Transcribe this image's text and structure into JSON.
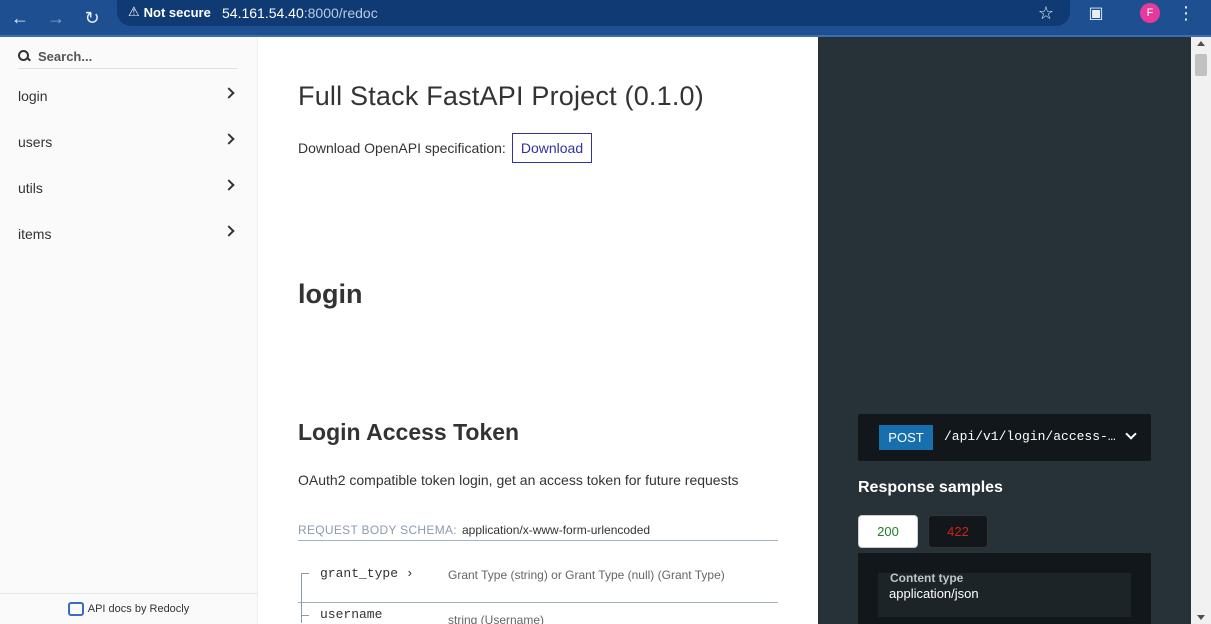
{
  "browser": {
    "security_label": "Not secure",
    "url_host": "54.161.54.40",
    "url_rest": ":8000/redoc",
    "avatar_letter": "F"
  },
  "sidebar": {
    "search_placeholder": "Search...",
    "items": [
      {
        "label": "login"
      },
      {
        "label": "users"
      },
      {
        "label": "utils"
      },
      {
        "label": "items"
      }
    ],
    "footer": "API docs by Redocly"
  },
  "main": {
    "title": "Full Stack FastAPI Project (0.1.0)",
    "download_label": "Download OpenAPI specification:",
    "download_button": "Download",
    "section_title": "login",
    "operation": {
      "title": "Login Access Token",
      "description": "OAuth2 compatible token login, get an access token for future requests",
      "schema_label": "REQUEST BODY SCHEMA:",
      "schema_type": "application/x-www-form-urlencoded",
      "fields": [
        {
          "name": "grant_type",
          "desc": "Grant Type (string) or Grant Type (null) (Grant Type)"
        },
        {
          "name": "username",
          "desc": "string (Username)"
        }
      ]
    }
  },
  "right_panel": {
    "method": "POST",
    "path": "/api/v1/login/access-…",
    "responses_title": "Response samples",
    "tabs": [
      "200",
      "422"
    ],
    "content_type_label": "Content type",
    "content_type_value": "application/json"
  },
  "colors": {
    "browser_bar": "#1d4f91",
    "right_panel": "#263238",
    "post_badge": "#186fad",
    "status_ok": "#1d8127",
    "status_error": "#d41f1c",
    "link": "#32329f"
  }
}
